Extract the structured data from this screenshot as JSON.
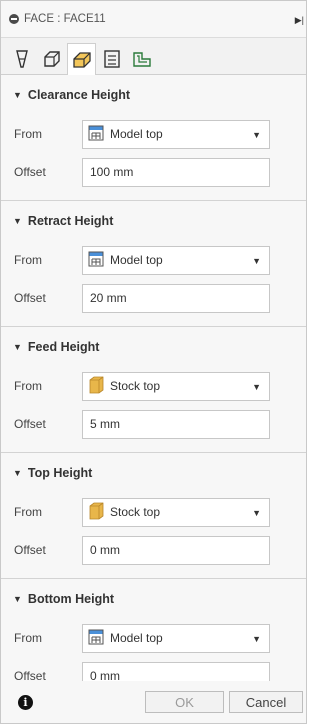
{
  "header": {
    "title": "FACE : FACE11"
  },
  "tabs": [
    {
      "name": "tool-tab-icon"
    },
    {
      "name": "geometry-tab-icon"
    },
    {
      "name": "heights-tab-icon"
    },
    {
      "name": "passes-tab-icon"
    },
    {
      "name": "linking-tab-icon"
    }
  ],
  "labels": {
    "from": "From",
    "offset": "Offset"
  },
  "sections": [
    {
      "title": "Clearance Height",
      "from": "Model top",
      "from_icon": "model-icon",
      "offset": "100 mm"
    },
    {
      "title": "Retract Height",
      "from": "Model top",
      "from_icon": "model-icon",
      "offset": "20 mm"
    },
    {
      "title": "Feed Height",
      "from": "Stock top",
      "from_icon": "stock-icon",
      "offset": "5 mm"
    },
    {
      "title": "Top Height",
      "from": "Stock top",
      "from_icon": "stock-icon",
      "offset": "0 mm"
    },
    {
      "title": "Bottom Height",
      "from": "Model top",
      "from_icon": "model-icon",
      "offset": "0 mm"
    }
  ],
  "footer": {
    "ok": "OK",
    "cancel": "Cancel",
    "info": "i"
  },
  "colors": {
    "stock_icon": "#e8b64a",
    "model_icon_accent": "#4a90d9"
  }
}
